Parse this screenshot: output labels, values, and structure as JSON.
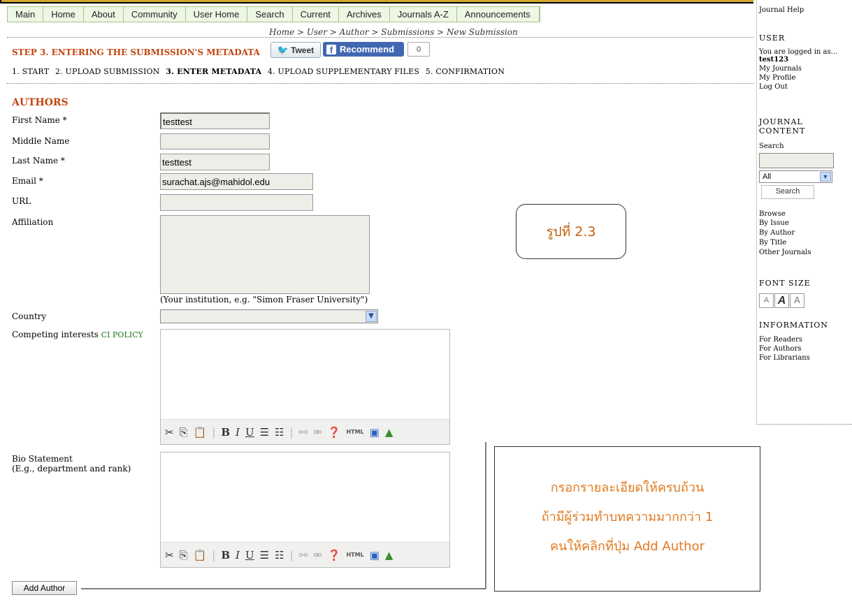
{
  "nav": [
    "Main",
    "Home",
    "About",
    "Community",
    "User Home",
    "Search",
    "Current",
    "Archives",
    "Journals A-Z",
    "Announcements"
  ],
  "breadcrumb": "Home > User > Author > Submissions > New Submission",
  "step_title": "STEP 3. ENTERING THE SUBMISSION'S METADATA",
  "social": {
    "tweet": "Tweet",
    "recommend": "Recommend",
    "count": "0"
  },
  "steps": [
    "1. START",
    "2. UPLOAD SUBMISSION",
    "3. ENTER METADATA",
    "4. UPLOAD SUPPLEMENTARY FILES",
    "5. CONFIRMATION"
  ],
  "section": "AUTHORS",
  "fields": {
    "first_name": {
      "label": "First Name *",
      "value": "testtest"
    },
    "middle_name": {
      "label": "Middle Name",
      "value": ""
    },
    "last_name": {
      "label": "Last Name *",
      "value": "testtest"
    },
    "email": {
      "label": "Email *",
      "value": "surachat.ajs@mahidol.edu"
    },
    "url": {
      "label": "URL",
      "value": ""
    },
    "affiliation": {
      "label": "Affiliation",
      "hint": "(Your institution, e.g. \"Simon Fraser University\")"
    },
    "country": {
      "label": "Country",
      "value": ""
    },
    "competing": {
      "label": "Competing interests",
      "link": "CI POLICY"
    },
    "bio": {
      "label": "Bio Statement",
      "sub": "(E.g., department and rank)"
    }
  },
  "add_author": "Add Author",
  "callout_figure": "รูปที่ 2.3",
  "callout_lines": [
    "กรอกรายละเอียดให้ครบถ้วน",
    "ถ้ามีผู้ร่วมทำบทความมากกว่า 1",
    "คนให้คลิกที่ปุ่ม Add Author"
  ],
  "sidebar": {
    "journal_help": "Journal Help",
    "user_head": "USER",
    "logged_in": "You are logged in as...",
    "username": "test123",
    "user_links": [
      "My Journals",
      "My Profile",
      "Log Out"
    ],
    "content_head": "JOURNAL CONTENT",
    "search_label": "Search",
    "scope": "All",
    "search_btn": "Search",
    "browse": "Browse",
    "browse_links": [
      "By Issue",
      "By Author",
      "By Title",
      "Other Journals"
    ],
    "font_head": "FONT SIZE",
    "info_head": "INFORMATION",
    "info_links": [
      "For Readers",
      "For Authors",
      "For Librarians"
    ]
  }
}
